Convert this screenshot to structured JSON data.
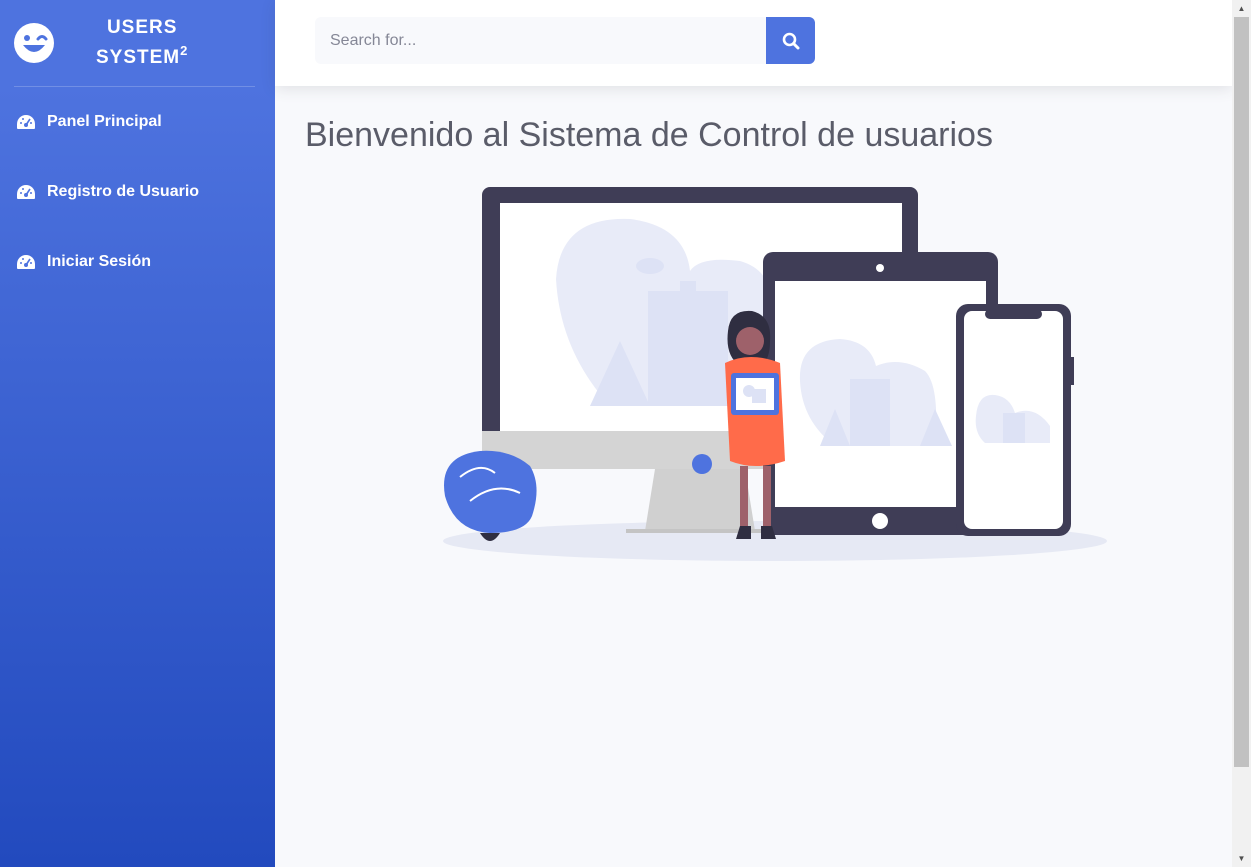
{
  "brand": {
    "line1": "USERS",
    "line2": "SYSTEM",
    "sup": "2",
    "icon": "grin-wink-icon"
  },
  "sidebar": {
    "items": [
      {
        "label": "Panel Principal",
        "icon": "tachometer-icon"
      },
      {
        "label": "Registro de Usuario",
        "icon": "tachometer-icon"
      },
      {
        "label": "Iniciar Sesión",
        "icon": "tachometer-icon"
      }
    ]
  },
  "search": {
    "placeholder": "Search for...",
    "value": "",
    "button_icon": "search-icon"
  },
  "main": {
    "title": "Bienvenido al Sistema de Control de usuarios"
  },
  "colors": {
    "primary": "#4e73df",
    "primary_dark": "#224abe",
    "background": "#f8f9fc",
    "text_gray": "#5a5c69",
    "illustration_dark": "#3f3d56",
    "illustration_accent": "#ff6b4a"
  }
}
